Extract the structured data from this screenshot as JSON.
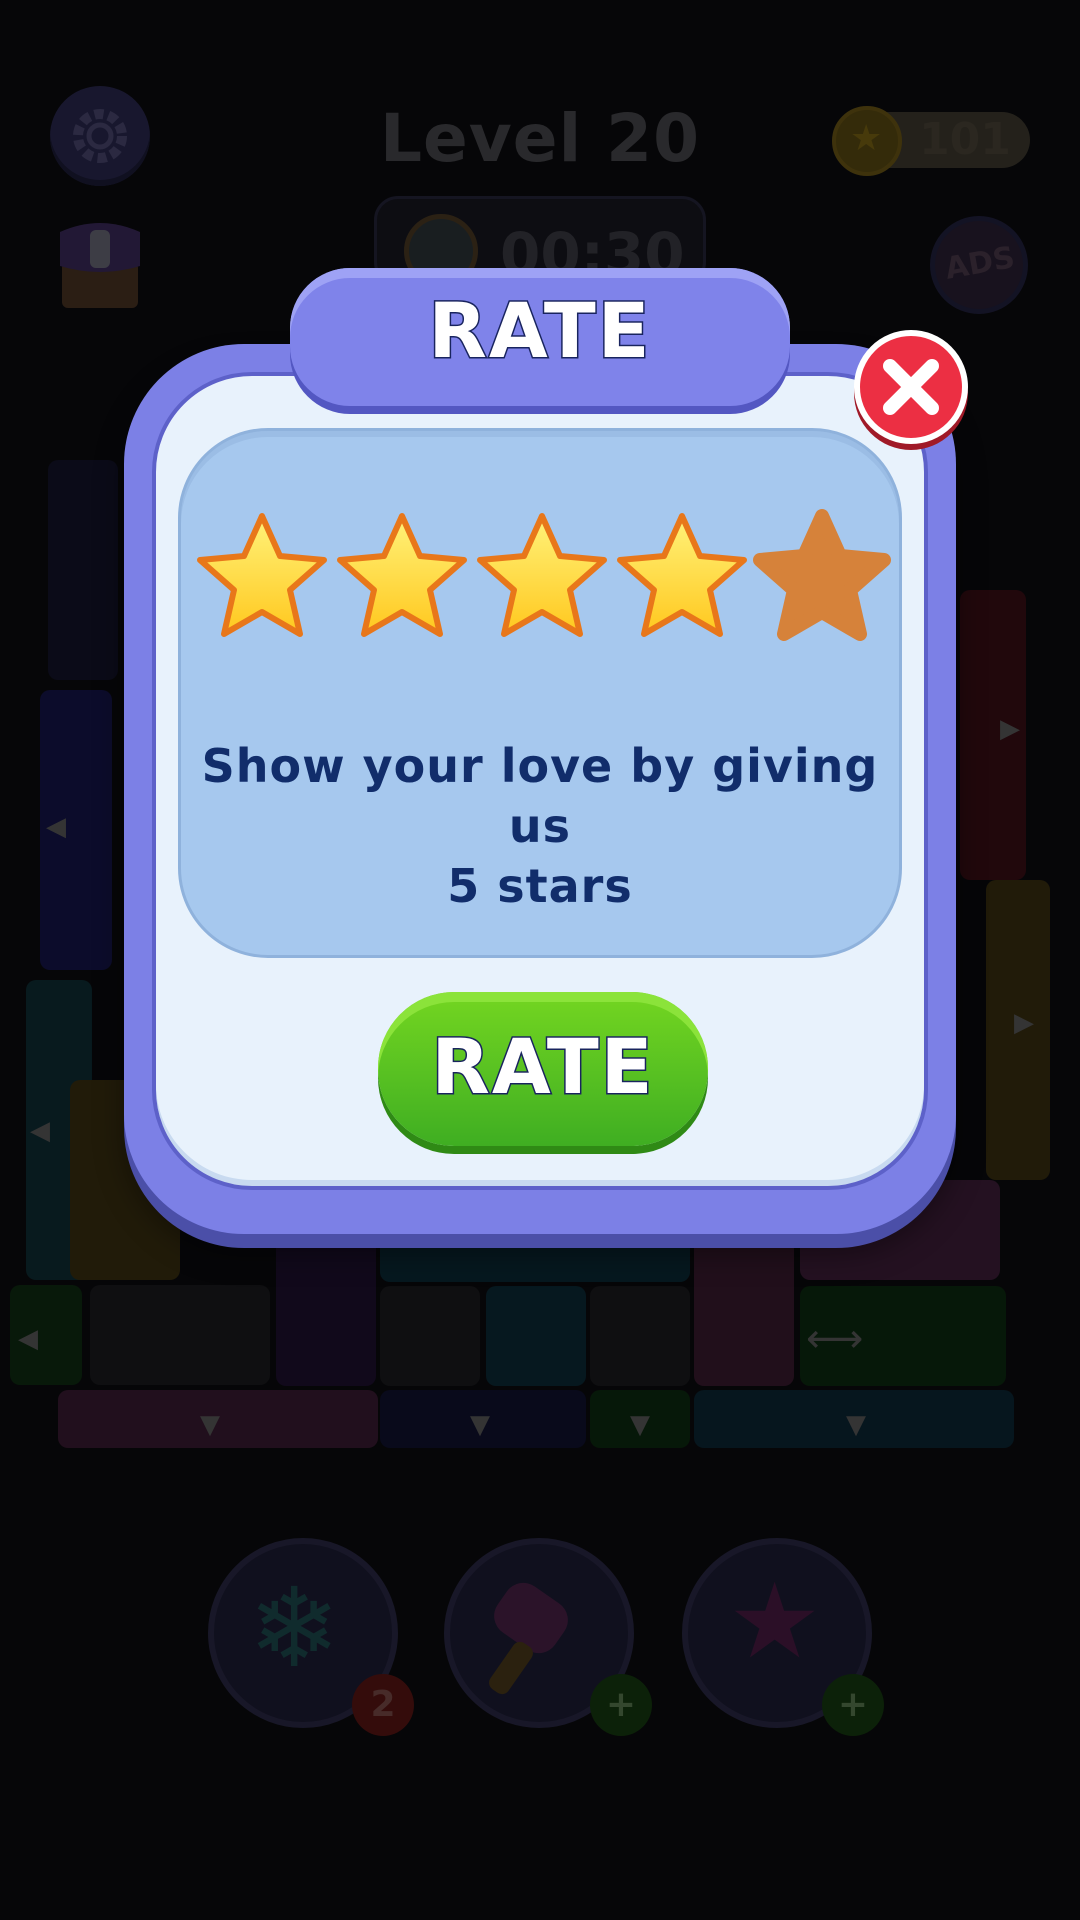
{
  "hud": {
    "level_title": "Level 20",
    "coins": "101",
    "timer": "00:30",
    "ads_label": "ADS"
  },
  "boosters": [
    {
      "name": "freeze",
      "badge": "2",
      "badge_color": "#c0211f"
    },
    {
      "name": "hammer",
      "badge": "+",
      "badge_color": "#3a9a1e"
    },
    {
      "name": "magic-wand",
      "badge": "+",
      "badge_color": "#3a9a1e"
    }
  ],
  "modal": {
    "title": "RATE",
    "message_line1": "Show your love by giving us",
    "message_line2": "5 stars",
    "button_label": "RATE",
    "rating": {
      "selected": 4,
      "max": 5
    },
    "colors": {
      "frame": "#7c80e6",
      "close": "#ec2f43",
      "button": "#4cbf22",
      "star_filled": "#ffc81e",
      "star_empty": "#d6823a",
      "message_text": "#112d6b"
    }
  }
}
